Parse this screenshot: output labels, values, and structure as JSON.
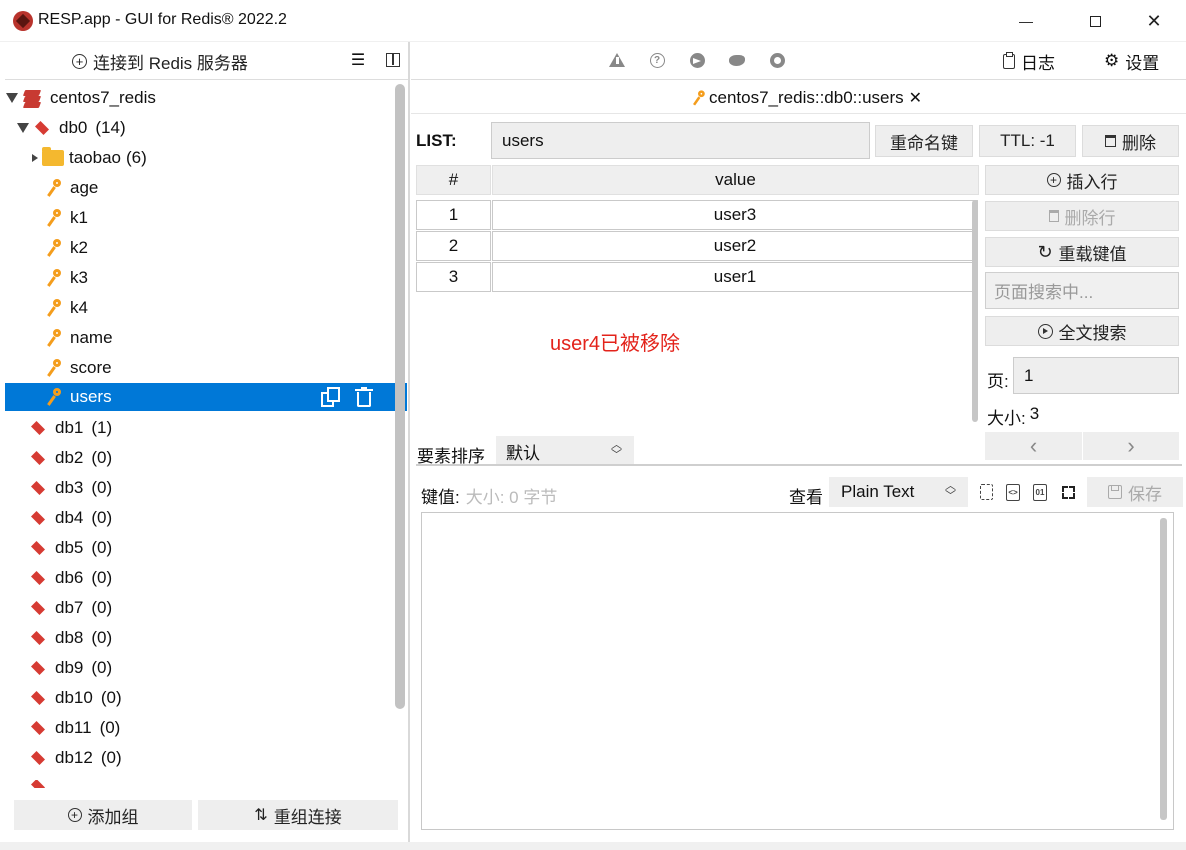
{
  "window": {
    "title": "RESP.app - GUI for Redis® 2022.2",
    "minimize": "—",
    "close": "✕"
  },
  "sidebar": {
    "connect_label": "连接到 Redis 服务器",
    "connection": "centos7_redis",
    "db0_label": "db0",
    "db0_count": "(14)",
    "folder_name": "taobao",
    "folder_count": "(6)",
    "keys": [
      "age",
      "k1",
      "k2",
      "k3",
      "k4",
      "name",
      "score",
      "users"
    ],
    "selected_key": "users",
    "dbs": [
      {
        "name": "db1",
        "count": "(1)"
      },
      {
        "name": "db2",
        "count": "(0)"
      },
      {
        "name": "db3",
        "count": "(0)"
      },
      {
        "name": "db4",
        "count": "(0)"
      },
      {
        "name": "db5",
        "count": "(0)"
      },
      {
        "name": "db6",
        "count": "(0)"
      },
      {
        "name": "db7",
        "count": "(0)"
      },
      {
        "name": "db8",
        "count": "(0)"
      },
      {
        "name": "db9",
        "count": "(0)"
      },
      {
        "name": "db10",
        "count": "(0)"
      },
      {
        "name": "db11",
        "count": "(0)"
      },
      {
        "name": "db12",
        "count": "(0)"
      }
    ],
    "add_group": "添加组",
    "regroup": "重组连接"
  },
  "toolbar": {
    "log": "日志",
    "settings": "设置"
  },
  "tab": {
    "title": "centos7_redis::db0::users",
    "close": "✕"
  },
  "key": {
    "type_label": "LIST:",
    "name": "users",
    "rename": "重命名键",
    "ttl": "TTL:  -1",
    "delete": "删除"
  },
  "table": {
    "col_index": "#",
    "col_value": "value",
    "rows": [
      {
        "index": "1",
        "value": "user3"
      },
      {
        "index": "2",
        "value": "user2"
      },
      {
        "index": "3",
        "value": "user1"
      }
    ]
  },
  "annotation": "user4已被移除",
  "actions": {
    "insert_row": "插入行",
    "delete_row": "删除行",
    "reload": "重载键值",
    "search_placeholder": "页面搜索中...",
    "fulltext": "全文搜索",
    "page_label": "页:",
    "page_value": "1",
    "size_label": "大小:",
    "size_value": "3",
    "prev": "‹",
    "next": "›"
  },
  "sort": {
    "label": "要素排序",
    "value": "默认"
  },
  "editor": {
    "value_label": "键值:",
    "size_text": "大小: 0 字节",
    "view_label": "查看",
    "format": "Plain Text",
    "save": "保存"
  }
}
